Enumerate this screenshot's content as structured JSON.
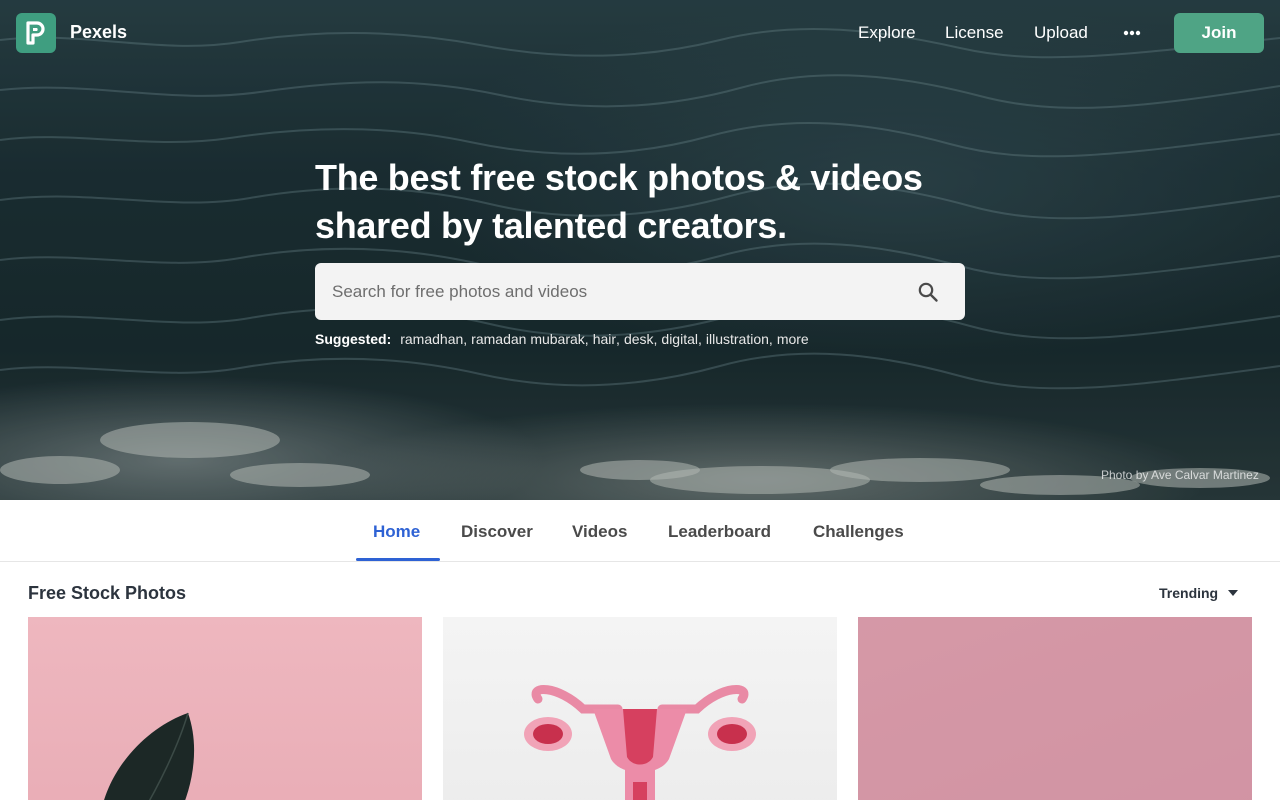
{
  "brand": {
    "name": "Pexels",
    "logo_letter": "P",
    "color": "#3f9e80"
  },
  "nav": {
    "links": [
      {
        "label": "Explore"
      },
      {
        "label": "License"
      },
      {
        "label": "Upload"
      }
    ],
    "more_icon": "ellipsis-icon",
    "join_label": "Join",
    "join_color": "#4fa485"
  },
  "hero": {
    "title": "The best free stock photos & videos shared by talented creators.",
    "search_placeholder": "Search for free photos and videos",
    "search_icon": "search-icon",
    "suggested_label": "Suggested:",
    "suggested": [
      {
        "label": "ramadhan"
      },
      {
        "label": "ramadan mubarak"
      },
      {
        "label": "hair"
      },
      {
        "label": "desk"
      },
      {
        "label": "digital"
      },
      {
        "label": "illustration"
      },
      {
        "label": "more"
      }
    ],
    "photo_credit": "Photo by Ave Calvar Martinez"
  },
  "tabs": {
    "items": [
      {
        "label": "Home",
        "active": true
      },
      {
        "label": "Discover",
        "active": false
      },
      {
        "label": "Videos",
        "active": false
      },
      {
        "label": "Leaderboard",
        "active": false
      },
      {
        "label": "Challenges",
        "active": false
      }
    ],
    "active_color": "#2e62d4"
  },
  "section": {
    "title": "Free Stock Photos",
    "sort_label": "Trending",
    "sort_icon": "caret-down-icon"
  },
  "photos": [
    {
      "subject": "dark-leaf-on-pink",
      "bg": "#eeb7bf"
    },
    {
      "subject": "paper-uterus-on-white",
      "bg": "#f2f2f2"
    },
    {
      "subject": "plain-pink-backdrop",
      "bg": "#d69aa8"
    }
  ]
}
